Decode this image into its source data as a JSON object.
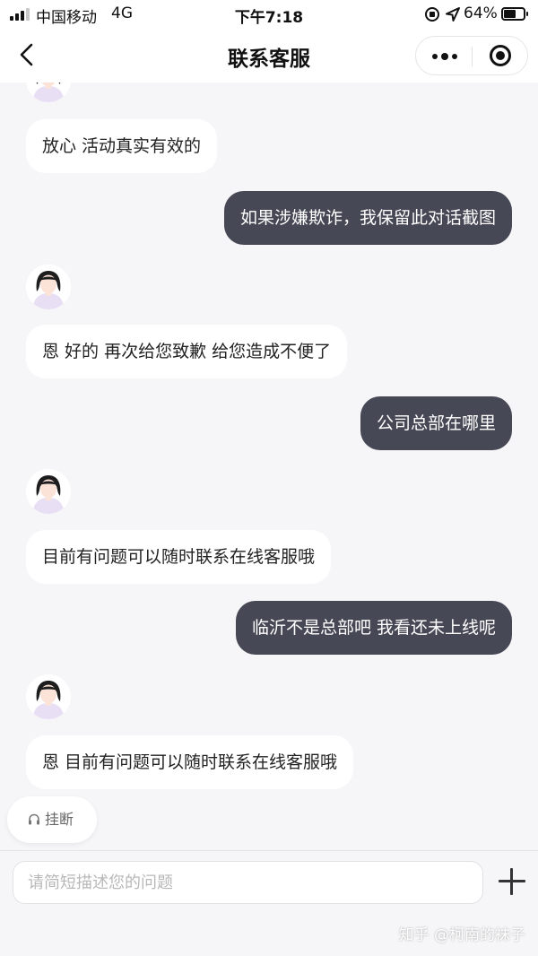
{
  "status_bar": {
    "carrier": "中国移动",
    "network": "4G",
    "time": "下午7:18",
    "battery_percent": "64%",
    "battery_level": 0.64
  },
  "nav": {
    "title": "联系客服",
    "back_icon": "chevron-left-icon",
    "more_icon": "more-dots-icon",
    "close_icon": "target-close-icon"
  },
  "colors": {
    "page_bg": "#f6f6f8",
    "agent_bubble": "#ffffff",
    "user_bubble": "#474855",
    "user_text": "#ffffff"
  },
  "messages": [
    {
      "sender": "agent",
      "text": "放心 活动真实有效的"
    },
    {
      "sender": "user",
      "text": "如果涉嫌欺诈，我保留此对话截图"
    },
    {
      "sender": "agent",
      "text": "恩 好的 再次给您致歉 给您造成不便了"
    },
    {
      "sender": "user",
      "text": "公司总部在哪里"
    },
    {
      "sender": "agent",
      "text": "目前有问题可以随时联系在线客服哦"
    },
    {
      "sender": "user",
      "text": "临沂不是总部吧 我看还未上线呢"
    },
    {
      "sender": "agent",
      "text": "恩 目前有问题可以随时联系在线客服哦"
    }
  ],
  "hangup": {
    "label": "挂断",
    "icon": "headset-icon"
  },
  "input": {
    "placeholder": "请简短描述您的问题",
    "value": "",
    "plus_icon": "plus-icon"
  },
  "watermark": "知乎 @柯南的袜子"
}
